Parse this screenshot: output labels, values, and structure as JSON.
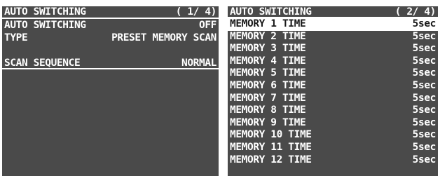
{
  "left_panel": {
    "title": "AUTO SWITCHING",
    "page": "( 1/ 4)",
    "items": [
      {
        "label": "AUTO SWITCHING",
        "value": "OFF"
      },
      {
        "label": "TYPE",
        "value": "PRESET MEMORY SCAN"
      },
      {
        "label": "SCAN SEQUENCE",
        "value": "NORMAL"
      }
    ]
  },
  "right_panel": {
    "title": "AUTO SWITCHING",
    "page": "( 2/ 4)",
    "items": [
      {
        "label": "MEMORY 1 TIME",
        "value": "5sec"
      },
      {
        "label": "MEMORY 2 TIME",
        "value": "5sec"
      },
      {
        "label": "MEMORY 3 TIME",
        "value": "5sec"
      },
      {
        "label": "MEMORY 4 TIME",
        "value": "5sec"
      },
      {
        "label": "MEMORY 5 TIME",
        "value": "5sec"
      },
      {
        "label": "MEMORY 6 TIME",
        "value": "5sec"
      },
      {
        "label": "MEMORY 7 TIME",
        "value": "5sec"
      },
      {
        "label": "MEMORY 8 TIME",
        "value": "5sec"
      },
      {
        "label": "MEMORY 9 TIME",
        "value": "5sec"
      },
      {
        "label": "MEMORY 10 TIME",
        "value": "5sec"
      },
      {
        "label": "MEMORY 11 TIME",
        "value": "5sec"
      },
      {
        "label": "MEMORY 12 TIME",
        "value": "5sec"
      }
    ]
  },
  "colors": {
    "panel_background": "#4a4a4a",
    "text": "#ffffff",
    "selection_background": "#ffffff",
    "selection_text": "#1a1a1a"
  }
}
